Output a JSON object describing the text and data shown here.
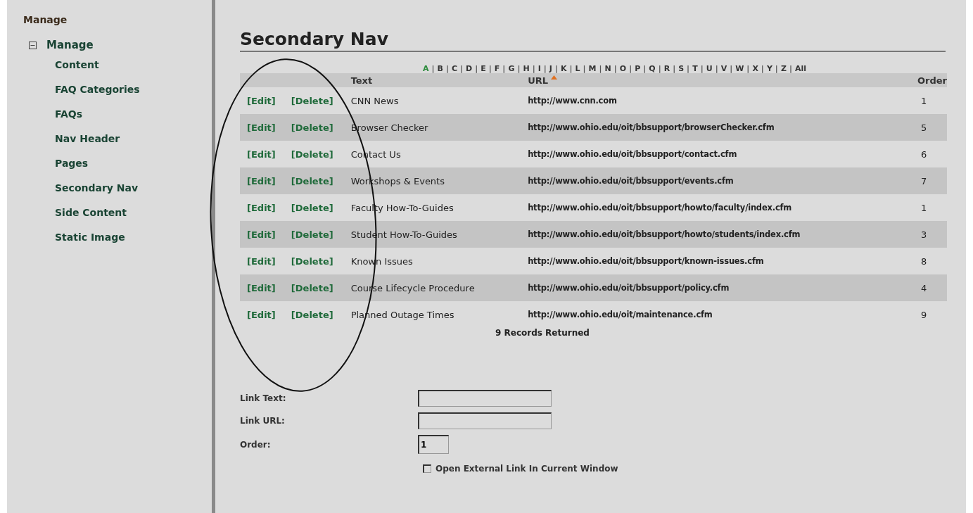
{
  "sidebar": {
    "heading": "Manage",
    "tree": {
      "label": "Manage",
      "expanded": true,
      "children": [
        {
          "label": "Content"
        },
        {
          "label": "FAQ Categories"
        },
        {
          "label": "FAQs"
        },
        {
          "label": "Nav Header"
        },
        {
          "label": "Pages"
        },
        {
          "label": "Secondary Nav"
        },
        {
          "label": "Side Content"
        },
        {
          "label": "Static Image"
        }
      ]
    }
  },
  "page_title": "Secondary Nav",
  "alphabet": [
    {
      "label": "A",
      "selected": true
    },
    {
      "label": "B",
      "selected": false
    },
    {
      "label": "C",
      "selected": false
    },
    {
      "label": "D",
      "selected": false
    },
    {
      "label": "E",
      "selected": false
    },
    {
      "label": "F",
      "selected": false
    },
    {
      "label": "G",
      "selected": false
    },
    {
      "label": "H",
      "selected": false
    },
    {
      "label": "I",
      "selected": false
    },
    {
      "label": "J",
      "selected": false
    },
    {
      "label": "K",
      "selected": false
    },
    {
      "label": "L",
      "selected": false
    },
    {
      "label": "M",
      "selected": false
    },
    {
      "label": "N",
      "selected": false
    },
    {
      "label": "O",
      "selected": false
    },
    {
      "label": "P",
      "selected": false
    },
    {
      "label": "Q",
      "selected": false
    },
    {
      "label": "R",
      "selected": false
    },
    {
      "label": "S",
      "selected": false
    },
    {
      "label": "T",
      "selected": false
    },
    {
      "label": "U",
      "selected": false
    },
    {
      "label": "V",
      "selected": false
    },
    {
      "label": "W",
      "selected": false
    },
    {
      "label": "X",
      "selected": false
    },
    {
      "label": "Y",
      "selected": false
    },
    {
      "label": "Z",
      "selected": false
    },
    {
      "label": "All",
      "selected": false
    }
  ],
  "alphabet_separator": "|",
  "table": {
    "columns": [
      {
        "label": "Text",
        "sorted": false
      },
      {
        "label": "URL",
        "sorted": true
      },
      {
        "label": "Order",
        "sorted": false
      }
    ],
    "rows": [
      {
        "edit": "[Edit]",
        "delete": "[Delete]",
        "text": "CNN News",
        "url": "http://www.cnn.com",
        "order": "1"
      },
      {
        "edit": "[Edit]",
        "delete": "[Delete]",
        "text": "Browser Checker",
        "url": "http://www.ohio.edu/oit/bbsupport/browserChecker.cfm",
        "order": "5"
      },
      {
        "edit": "[Edit]",
        "delete": "[Delete]",
        "text": "Contact Us",
        "url": "http://www.ohio.edu/oit/bbsupport/contact.cfm",
        "order": "6"
      },
      {
        "edit": "[Edit]",
        "delete": "[Delete]",
        "text": "Workshops & Events",
        "url": "http://www.ohio.edu/oit/bbsupport/events.cfm",
        "order": "7"
      },
      {
        "edit": "[Edit]",
        "delete": "[Delete]",
        "text": "Faculty How-To-Guides",
        "url": "http://www.ohio.edu/oit/bbsupport/howto/faculty/index.cfm",
        "order": "1"
      },
      {
        "edit": "[Edit]",
        "delete": "[Delete]",
        "text": "Student How-To-Guides",
        "url": "http://www.ohio.edu/oit/bbsupport/howto/students/index.cfm",
        "order": "3"
      },
      {
        "edit": "[Edit]",
        "delete": "[Delete]",
        "text": "Known Issues",
        "url": "http://www.ohio.edu/oit/bbsupport/known-issues.cfm",
        "order": "8"
      },
      {
        "edit": "[Edit]",
        "delete": "[Delete]",
        "text": "Course Lifecycle Procedure",
        "url": "http://www.ohio.edu/oit/bbsupport/policy.cfm",
        "order": "4"
      },
      {
        "edit": "[Edit]",
        "delete": "[Delete]",
        "text": "Planned Outage Times",
        "url": "http://www.ohio.edu/oit/maintenance.cfm",
        "order": "9"
      }
    ],
    "footer": "9 Records Returned"
  },
  "form": {
    "fields": [
      {
        "label": "Link Text:",
        "kind": "wide"
      },
      {
        "label": "Link URL:",
        "kind": "wide"
      },
      {
        "label": "Order:",
        "value": "1",
        "kind": "narrow"
      }
    ],
    "checkbox": {
      "label": "Open External Link In Current Window",
      "checked": false
    }
  }
}
